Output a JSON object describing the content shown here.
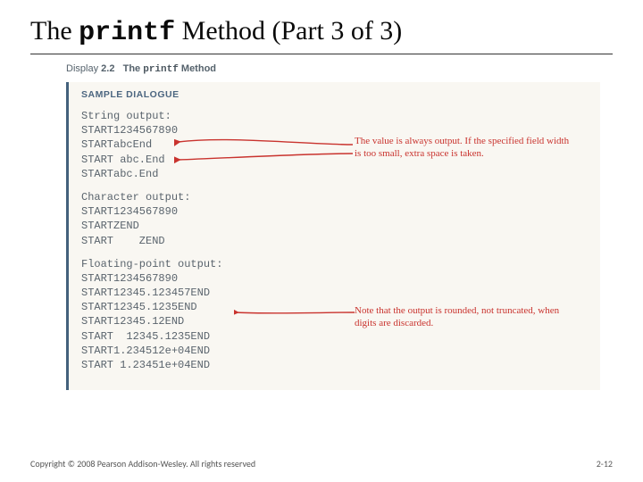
{
  "title": {
    "pre": "The ",
    "code": "printf",
    "post": " Method (Part 3 of 3)"
  },
  "display": {
    "label": "Display",
    "num": "2.2",
    "rest1": "The ",
    "code": "printf",
    "rest2": " Method"
  },
  "sampleHeading": "SAMPLE DIALOGUE",
  "blocks": {
    "string": "String output:\nSTART1234567890\nSTARTabcEnd\nSTART abc.End\nSTARTabc.End",
    "char": "Character output:\nSTART1234567890\nSTARTZEND\nSTART    ZEND",
    "float": "Floating-point output:\nSTART1234567890\nSTART12345.123457END\nSTART12345.1235END\nSTART12345.12END\nSTART  12345.1235END\nSTART1.234512e+04END\nSTART 1.23451e+04END"
  },
  "annotations": {
    "a1": "The value is always output. If the specified field width is too small, extra space is taken.",
    "a2": "Note that the output is rounded, not truncated, when digits are discarded."
  },
  "footer": {
    "copyright": "Copyright © 2008 Pearson Addison-Wesley. All rights reserved",
    "page": "2-12"
  }
}
